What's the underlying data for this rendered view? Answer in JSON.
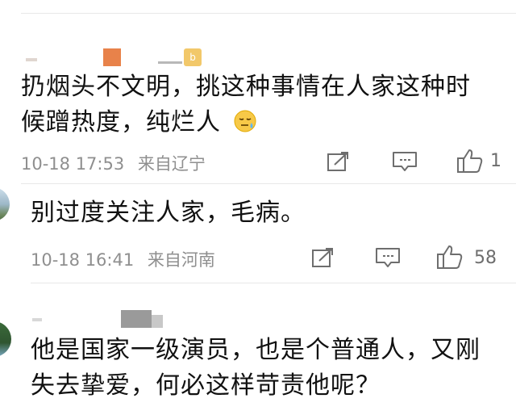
{
  "comments": [
    {
      "text_line1": "扔烟头不文明，挑这种事情在人家这种时",
      "text_line2": "候蹭热度，纯烂人",
      "emoji": "sweat-face-icon",
      "time": "10-18 17:53",
      "location": "来自辽宁",
      "likes": "1"
    },
    {
      "text_line1": "别过度关注人家，毛病。",
      "time": "10-18 16:41",
      "location": "来自河南",
      "likes": "58"
    },
    {
      "text_line1": "他是国家一级演员，也是个普通人，又刚",
      "text_line2": "失去挚爱，何必这样苛责他呢？"
    }
  ],
  "icons": {
    "share": "share-icon",
    "comment": "comment-icon",
    "like": "thumbs-up-icon"
  },
  "colors": {
    "text": "#111111",
    "meta": "#8f8f8f",
    "icon": "#6e6e6e",
    "divider": "#e8e8e8"
  }
}
